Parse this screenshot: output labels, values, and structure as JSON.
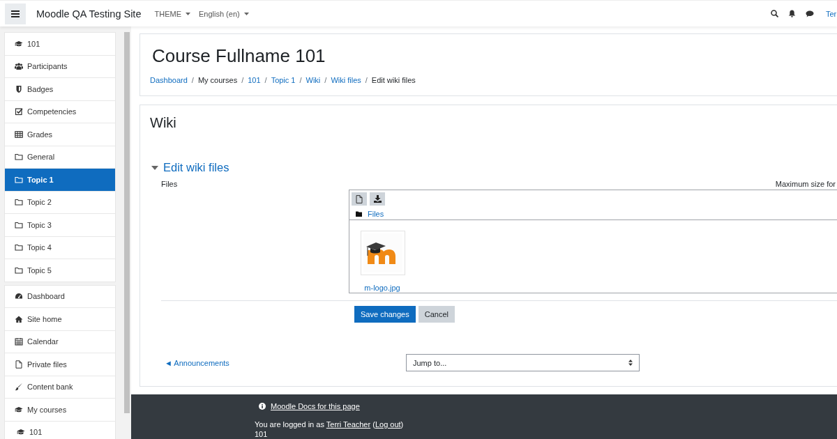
{
  "navbar": {
    "site_name": "Moodle QA Testing Site",
    "menus": [
      "THEME",
      "English (en)"
    ],
    "user": "Ter"
  },
  "sidebar": {
    "groups": [
      {
        "items": [
          {
            "label": "101",
            "selected": false
          },
          {
            "label": "Participants",
            "selected": false
          },
          {
            "label": "Badges",
            "selected": false
          },
          {
            "label": "Competencies",
            "selected": false
          },
          {
            "label": "Grades",
            "selected": false
          },
          {
            "label": "General",
            "selected": false
          },
          {
            "label": "Topic 1",
            "selected": true
          },
          {
            "label": "Topic 2",
            "selected": false
          },
          {
            "label": "Topic 3",
            "selected": false
          },
          {
            "label": "Topic 4",
            "selected": false
          },
          {
            "label": "Topic 5",
            "selected": false
          }
        ]
      },
      {
        "items": [
          {
            "label": "Dashboard",
            "selected": false
          },
          {
            "label": "Site home",
            "selected": false
          },
          {
            "label": "Calendar",
            "selected": false
          },
          {
            "label": "Private files",
            "selected": false
          },
          {
            "label": "Content bank",
            "selected": false
          },
          {
            "label": "My courses",
            "selected": false,
            "children": [
              {
                "label": "101",
                "selected": false
              }
            ]
          }
        ]
      }
    ]
  },
  "header": {
    "title": "Course Fullname 101",
    "breadcrumb": [
      {
        "label": "Dashboard",
        "link": true
      },
      {
        "sep": "/",
        "label": "My courses",
        "link": false
      },
      {
        "sep": "/",
        "label": "101",
        "link": true
      },
      {
        "sep": "/",
        "label": "Topic 1",
        "link": true
      },
      {
        "sep": "/",
        "label": "Wiki",
        "link": true
      },
      {
        "sep": "/",
        "label": "Wiki files",
        "link": true
      },
      {
        "sep": "/",
        "label": "Edit wiki files",
        "link": false
      }
    ]
  },
  "activity": {
    "title": "Wiki",
    "section": {
      "title": "Edit wiki files",
      "expanded": true
    },
    "files_label": "Files",
    "max_size": "Maximum size for",
    "file_manager": {
      "path": "Files",
      "files": [
        {
          "name": "m-logo.jpg"
        }
      ]
    },
    "buttons": [
      {
        "label": "Save changes",
        "kind": "primary"
      },
      {
        "label": "Cancel",
        "kind": "secondary"
      }
    ],
    "prev_link": "◄ Announcements",
    "jump_placeholder": "Jump to..."
  },
  "footer": {
    "docs_link": "Moodle Docs for this page",
    "login_prefix": "You are logged in as",
    "user_link": "Terri Teacher",
    "open_paren": "(",
    "logout_link": "Log out",
    "close_paren": ")",
    "course": "101"
  }
}
